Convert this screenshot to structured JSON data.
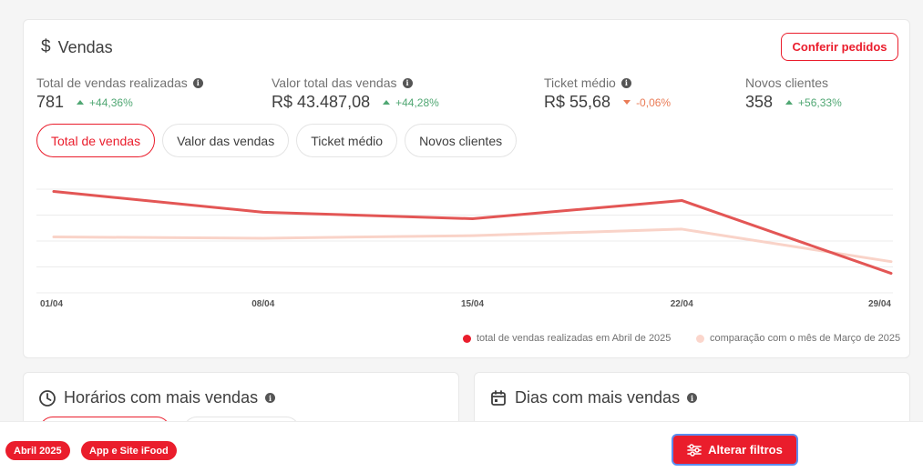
{
  "sales": {
    "title": "Vendas",
    "title_icon": "dollar-icon",
    "conferir_label": "Conferir pedidos",
    "metrics": [
      {
        "label": "Total de vendas realizadas",
        "value": "781",
        "delta": "+44,36%",
        "trend": "up"
      },
      {
        "label": "Valor total das vendas",
        "value": "R$ 43.487,08",
        "delta": "+44,28%",
        "trend": "up"
      },
      {
        "label": "Ticket médio",
        "value": "R$ 55,68",
        "delta": "-0,06%",
        "trend": "down"
      },
      {
        "label": "Novos clientes",
        "value": "358",
        "delta": "+56,33%",
        "trend": "up"
      }
    ],
    "tabs": [
      {
        "label": "Total de vendas",
        "active": true
      },
      {
        "label": "Valor das vendas",
        "active": false
      },
      {
        "label": "Ticket médio",
        "active": false
      },
      {
        "label": "Novos clientes",
        "active": false
      }
    ]
  },
  "chart_data": {
    "type": "line",
    "categories": [
      "01/04",
      "08/04",
      "15/04",
      "22/04",
      "29/04"
    ],
    "x_positions": [
      0,
      7,
      14,
      21,
      28
    ],
    "series": [
      {
        "name": "total de vendas realizadas em Abril de 2025",
        "color": "#e35655",
        "x": [
          0,
          7,
          14,
          21,
          28
        ],
        "values": [
          78,
          62,
          57,
          71,
          15
        ]
      },
      {
        "name": "comparação com o mês de Março de 2025",
        "color": "#f9d3c8",
        "x": [
          0,
          7,
          14,
          21,
          28
        ],
        "values": [
          43,
          42,
          44,
          49,
          24
        ]
      }
    ],
    "ylim": [
      0,
      100
    ],
    "grid": true,
    "legend": "bottom-right"
  },
  "hours": {
    "title": "Horários com mais vendas",
    "title_icon": "clock-icon"
  },
  "days": {
    "title": "Dias com mais vendas",
    "title_icon": "calendar-icon"
  },
  "bottom": {
    "chips": [
      "Abril 2025",
      "App e Site iFood"
    ],
    "filter_label": "Alterar filtros",
    "filter_icon": "sliders-icon"
  },
  "colors": {
    "accent": "#ea1d2c",
    "positive": "#50a773",
    "negative": "#ea7c57"
  }
}
